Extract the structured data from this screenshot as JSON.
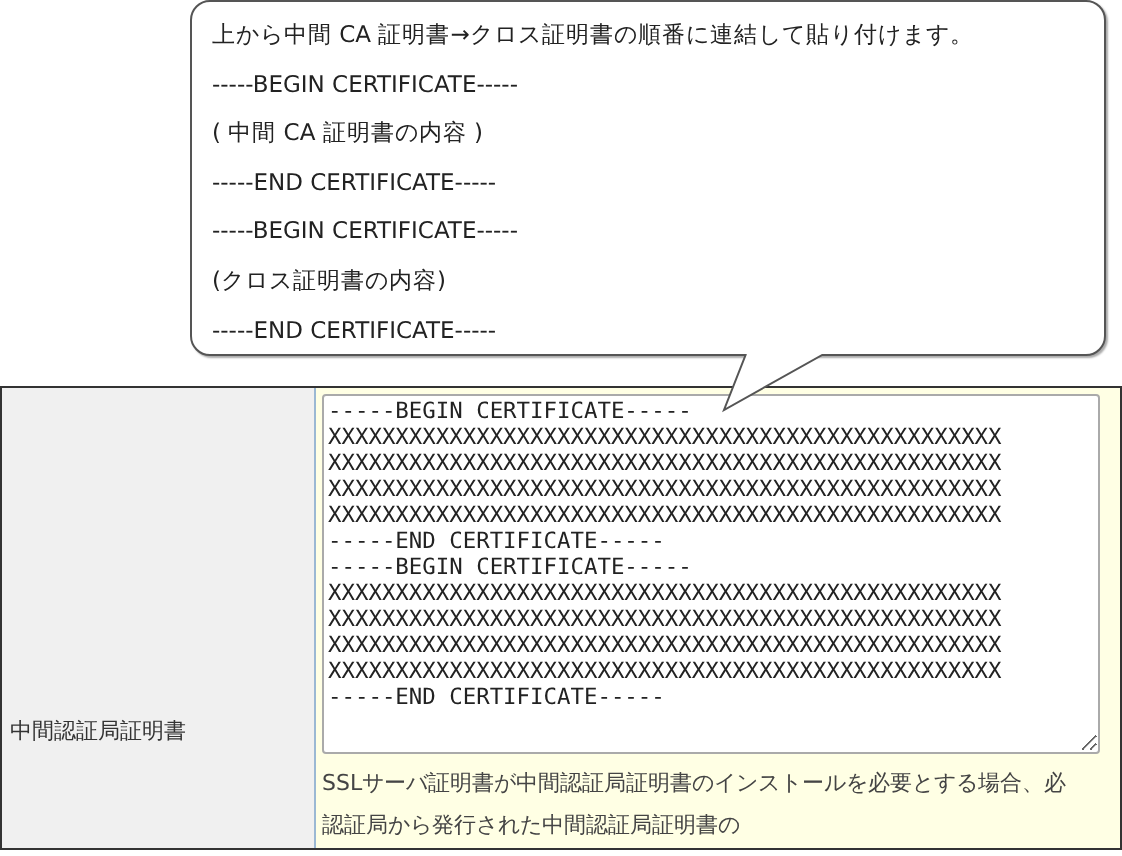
{
  "callout": {
    "lines": [
      "上から中間 CA 証明書→クロス証明書の順番に連結して貼り付けます。",
      "-----BEGIN CERTIFICATE-----",
      "( 中間 CA 証明書の内容 )",
      "-----END CERTIFICATE-----",
      "-----BEGIN CERTIFICATE-----",
      "(クロス証明書の内容)",
      "-----END CERTIFICATE-----"
    ]
  },
  "form_row": {
    "label": "中間認証局証明書",
    "certificate_field": {
      "value": "-----BEGIN CERTIFICATE-----\nXXXXXXXXXXXXXXXXXXXXXXXXXXXXXXXXXXXXXXXXXXXXXXXXXX\nXXXXXXXXXXXXXXXXXXXXXXXXXXXXXXXXXXXXXXXXXXXXXXXXXX\nXXXXXXXXXXXXXXXXXXXXXXXXXXXXXXXXXXXXXXXXXXXXXXXXXX\nXXXXXXXXXXXXXXXXXXXXXXXXXXXXXXXXXXXXXXXXXXXXXXXXXX\n-----END CERTIFICATE-----\n-----BEGIN CERTIFICATE-----\nXXXXXXXXXXXXXXXXXXXXXXXXXXXXXXXXXXXXXXXXXXXXXXXXXX\nXXXXXXXXXXXXXXXXXXXXXXXXXXXXXXXXXXXXXXXXXXXXXXXXXX\nXXXXXXXXXXXXXXXXXXXXXXXXXXXXXXXXXXXXXXXXXXXXXXXXXX\nXXXXXXXXXXXXXXXXXXXXXXXXXXXXXXXXXXXXXXXXXXXXXXXXXX\n-----END CERTIFICATE-----"
    },
    "help_text_lines": [
      "SSLサーバ証明書が中間認証局証明書のインストールを必要とする場合、必",
      "認証局から発行された中間認証局証明書の"
    ]
  }
}
